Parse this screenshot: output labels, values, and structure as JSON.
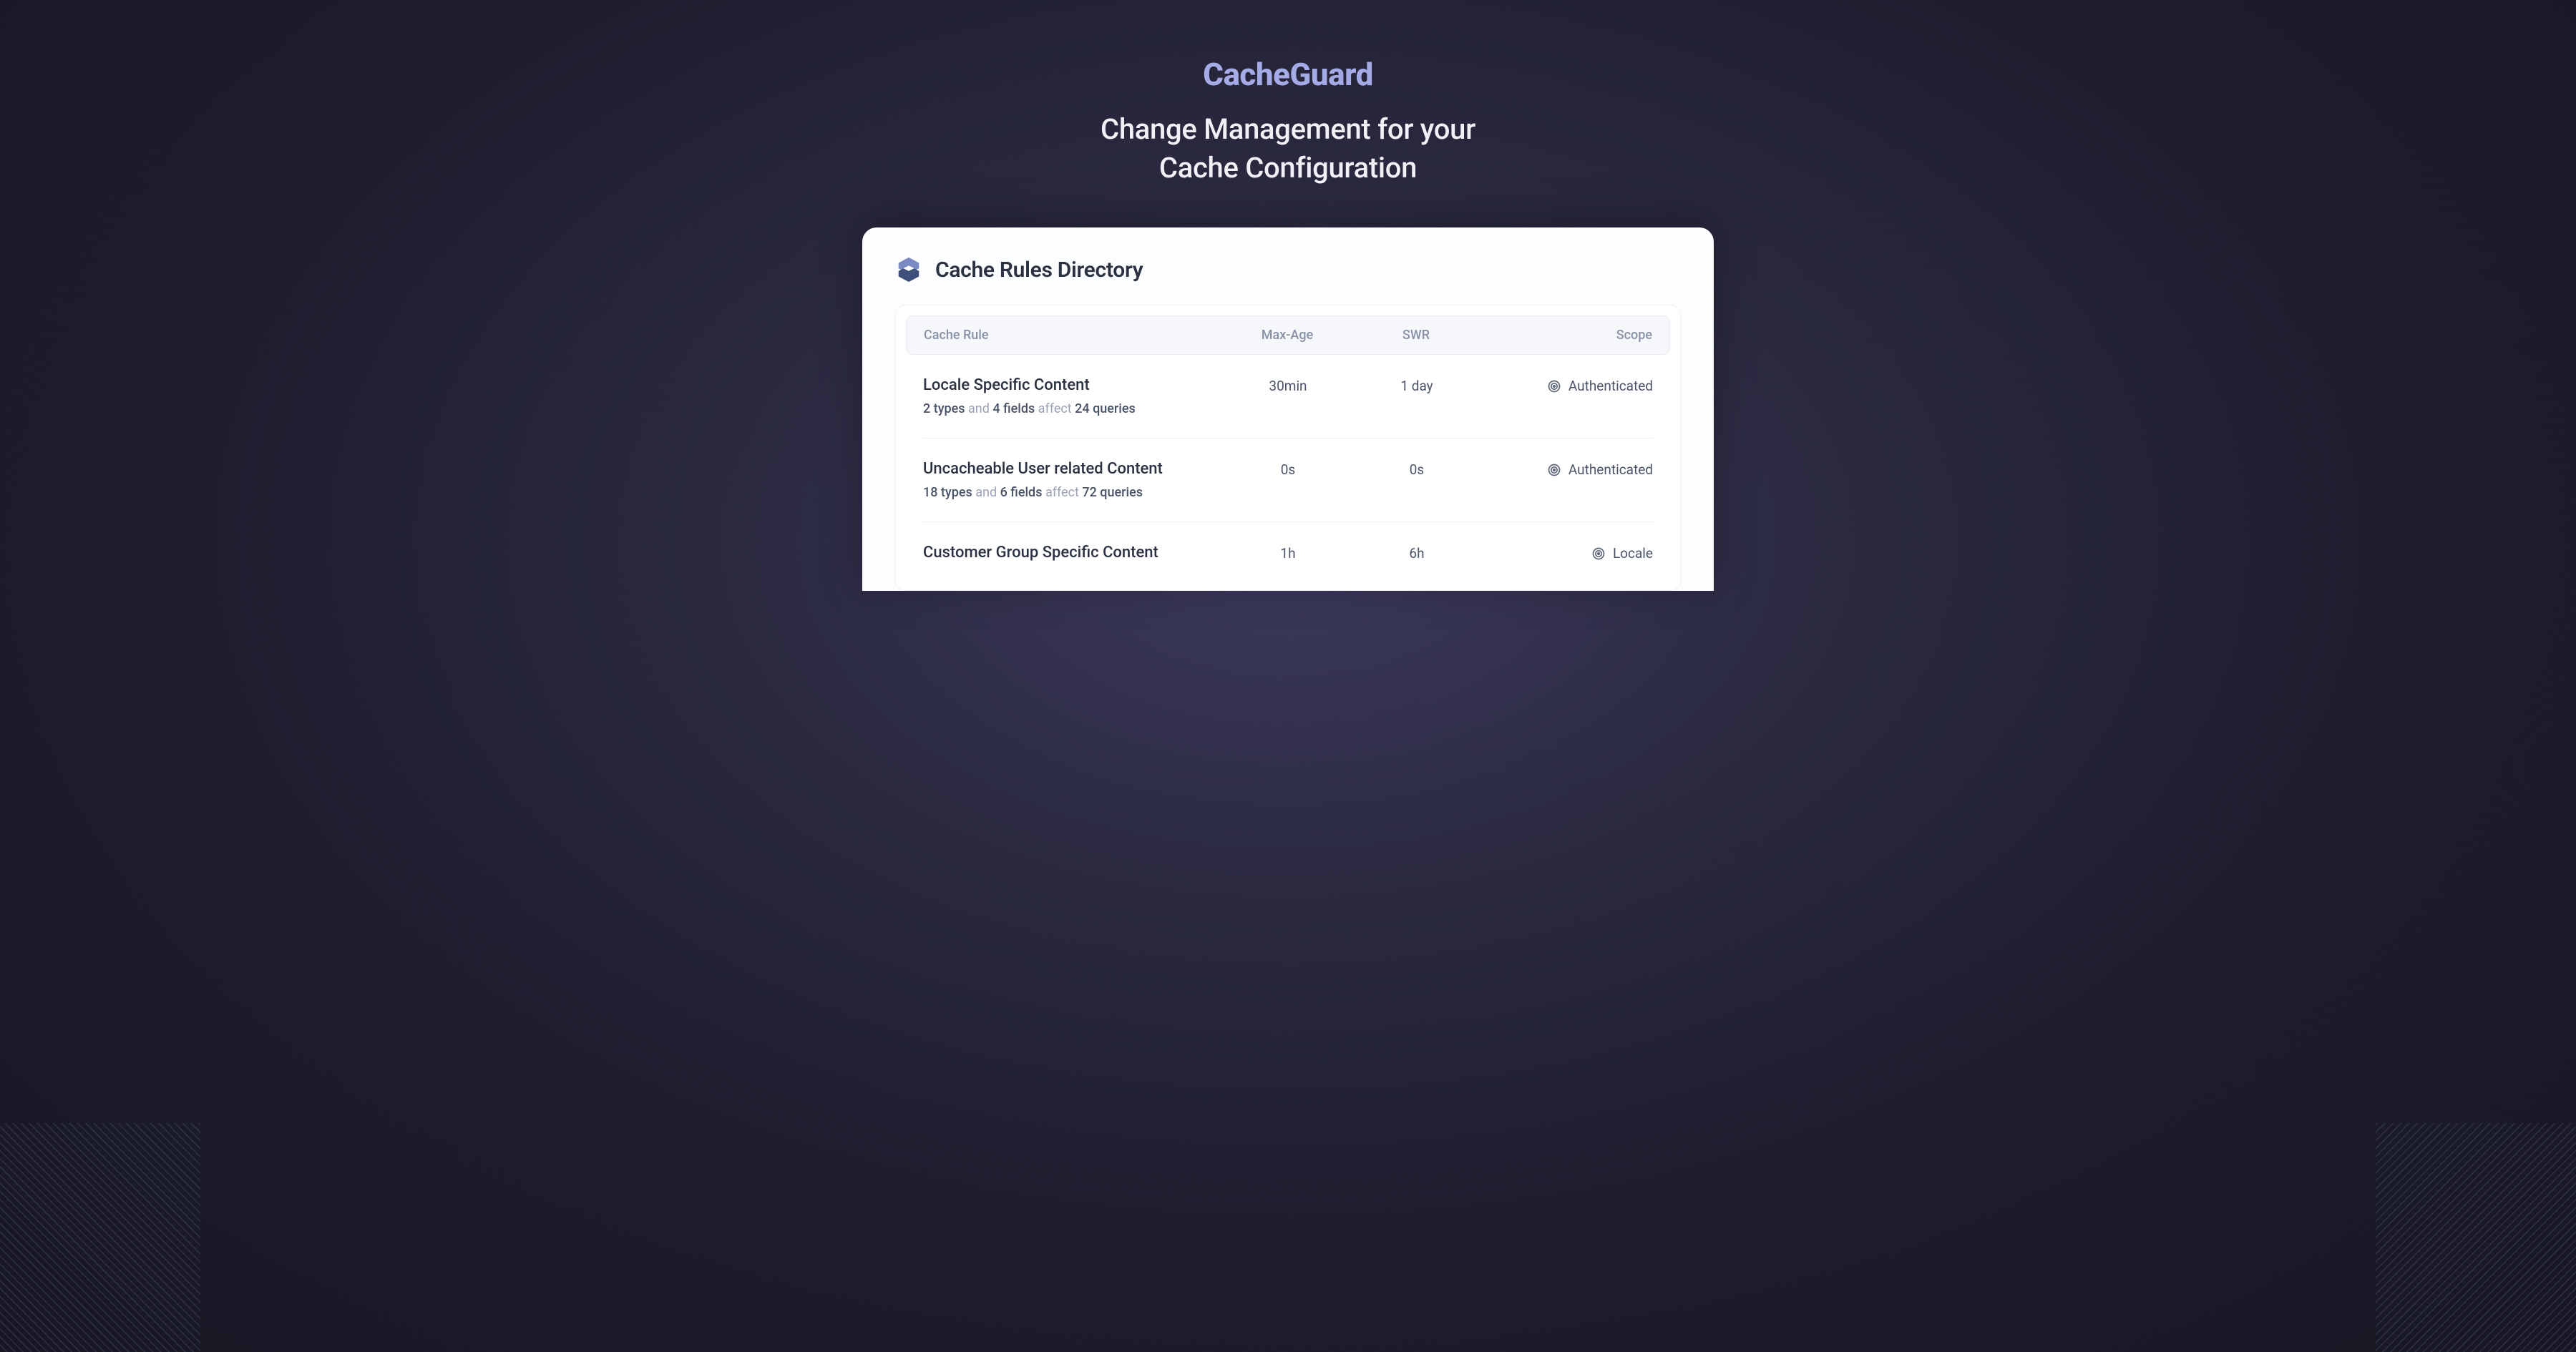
{
  "hero": {
    "brand": "CacheGuard",
    "tagline_l1": "Change Management for your",
    "tagline_l2": "Cache Configuration"
  },
  "panel": {
    "title": "Cache Rules Directory"
  },
  "columns": {
    "rule": "Cache Rule",
    "maxage": "Max-Age",
    "swr": "SWR",
    "scope": "Scope"
  },
  "words": {
    "and": "and",
    "affect": "affect"
  },
  "rules": [
    {
      "name": "Locale Specific Content",
      "types": "2 types",
      "fields": "4 fields",
      "queries": "24 queries",
      "maxage": "30min",
      "swr": "1 day",
      "scope": "Authenticated"
    },
    {
      "name": "Uncacheable User related Content",
      "types": "18 types",
      "fields": "6 fields",
      "queries": "72 queries",
      "maxage": "0s",
      "swr": "0s",
      "scope": "Authenticated"
    },
    {
      "name": "Customer Group Specific Content",
      "types": "",
      "fields": "",
      "queries": "",
      "maxage": "1h",
      "swr": "6h",
      "scope": "Locale"
    }
  ]
}
